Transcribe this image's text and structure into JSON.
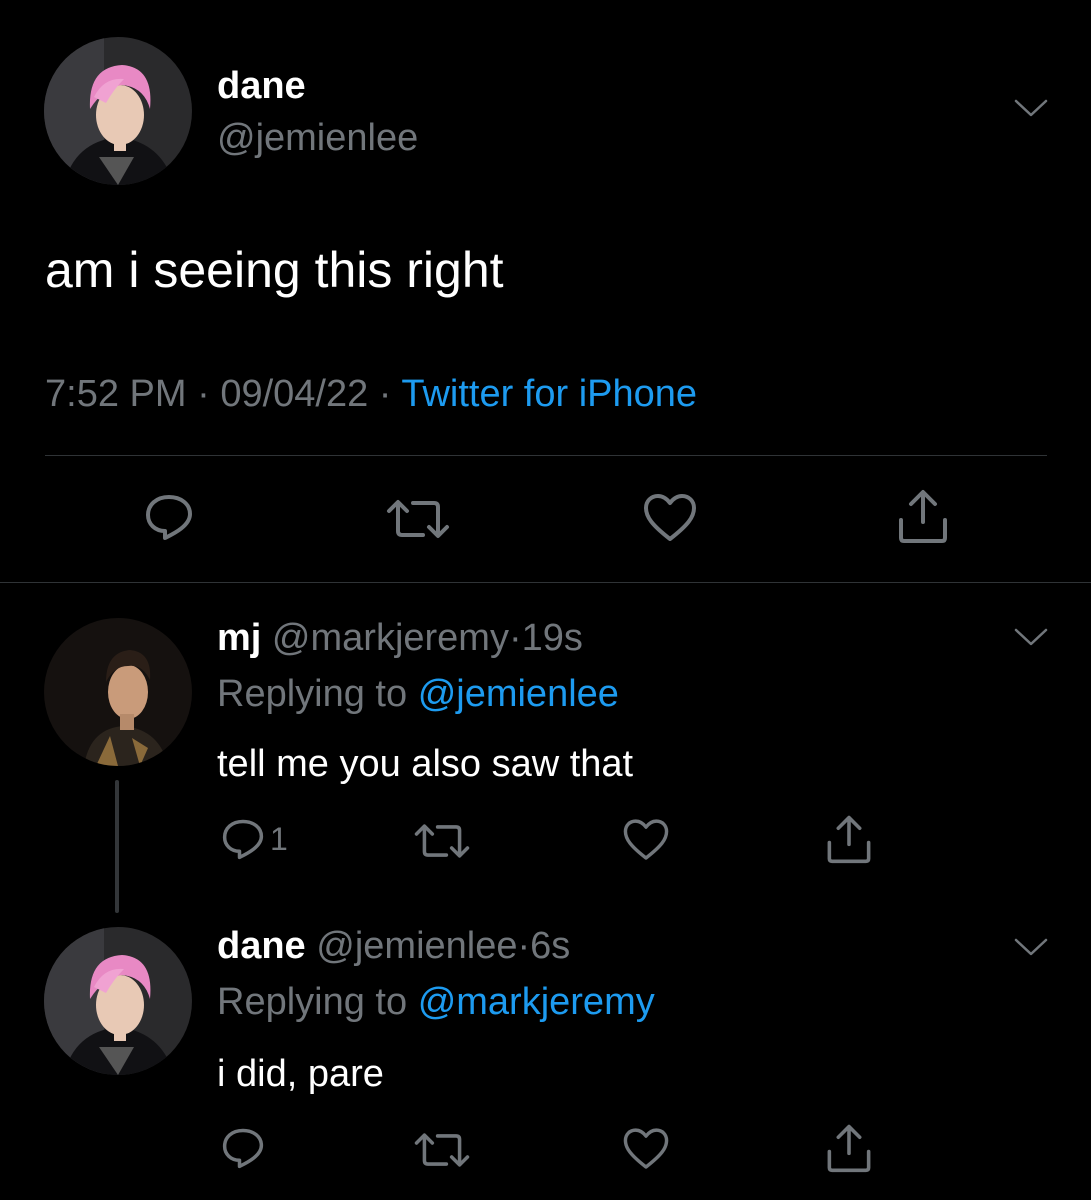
{
  "main_tweet": {
    "name": "dane",
    "handle": "@jemienlee",
    "text": "am i seeing this right",
    "time": "7:52 PM",
    "separator": "·",
    "date": "09/04/22",
    "source": "Twitter for iPhone",
    "actions": [
      "reply-icon",
      "retweet-icon",
      "like-icon",
      "share-icon"
    ]
  },
  "replies": [
    {
      "name": "mj",
      "handle": "@markjeremy",
      "dot": "·",
      "time": "19s",
      "replying_prefix": "Replying to",
      "replying_to": "@jemienlee",
      "text": "tell me you also saw that",
      "reply_count": "1"
    },
    {
      "name": "dane",
      "handle": "@jemienlee",
      "dot": "·",
      "time": "6s",
      "replying_prefix": "Replying to",
      "replying_to": "@markjeremy",
      "text": "i did, pare",
      "reply_count": ""
    }
  ],
  "colors": {
    "background": "#000000",
    "text": "#ffffff",
    "muted": "#71767b",
    "link": "#1d9bf0",
    "avatar_hair": "#e889c4"
  }
}
